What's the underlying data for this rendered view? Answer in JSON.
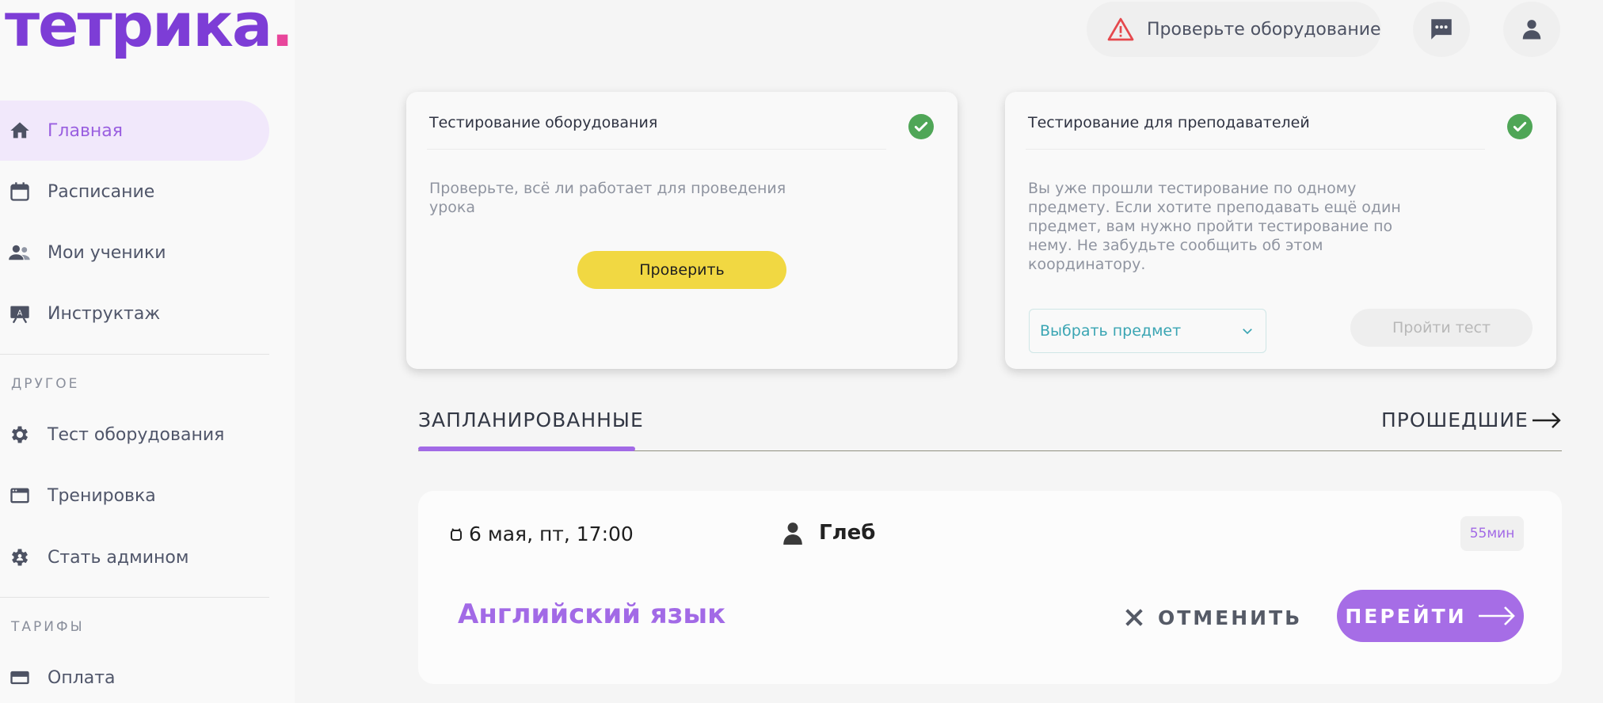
{
  "brand": {
    "logo": "тетрика"
  },
  "header": {
    "warning_label": "Проверьте оборудование"
  },
  "sidebar": {
    "items": [
      {
        "label": "Главная",
        "icon": "home-icon"
      },
      {
        "label": "Расписание",
        "icon": "calendar-icon"
      },
      {
        "label": "Мои ученики",
        "icon": "people-icon"
      },
      {
        "label": "Инструктаж",
        "icon": "board-icon"
      }
    ],
    "section_other": "ДРУГОЕ",
    "other_items": [
      {
        "label": "Тест оборудования",
        "icon": "gear-icon"
      },
      {
        "label": "Тренировка",
        "icon": "window-icon"
      },
      {
        "label": "Стать админом",
        "icon": "admin-gear-icon"
      }
    ],
    "section_tariffs": "ТАРИФЫ",
    "tariff_items": [
      {
        "label": "Оплата",
        "icon": "card-icon"
      }
    ]
  },
  "card_equipment": {
    "title": "Тестирование оборудования",
    "description_line1": "Проверьте, всё ли работает для проведения",
    "description_line2": "урока",
    "button": "Проверить"
  },
  "card_teachers": {
    "title": "Тестирование для преподавателей",
    "description_lines": [
      "Вы уже прошли тестирование по одному",
      "предмету. Если хотите преподавать ещё один",
      "предмет, вам нужно пройти тестирование по",
      "нему. Не забудьте сообщить об этом",
      "координатору."
    ],
    "select_placeholder": "Выбрать предмет",
    "button": "Пройти тест"
  },
  "tabs": {
    "planned": "ЗАПЛАНИРОВАННЫЕ",
    "past": "ПРОШЕДШИЕ"
  },
  "lesson": {
    "datetime": "6 мая, пт, 17:00",
    "student": "Глеб",
    "duration": "55мин",
    "subject": "Английский язык",
    "cancel": "ОТМЕНИТЬ",
    "go": "ПЕРЕЙТИ"
  },
  "colors": {
    "brand_purple": "#7d3dd6",
    "accent_purple": "#a26ae6",
    "yellow": "#f1d842",
    "check_green": "#4fa657",
    "warning_red": "#e5484d"
  }
}
